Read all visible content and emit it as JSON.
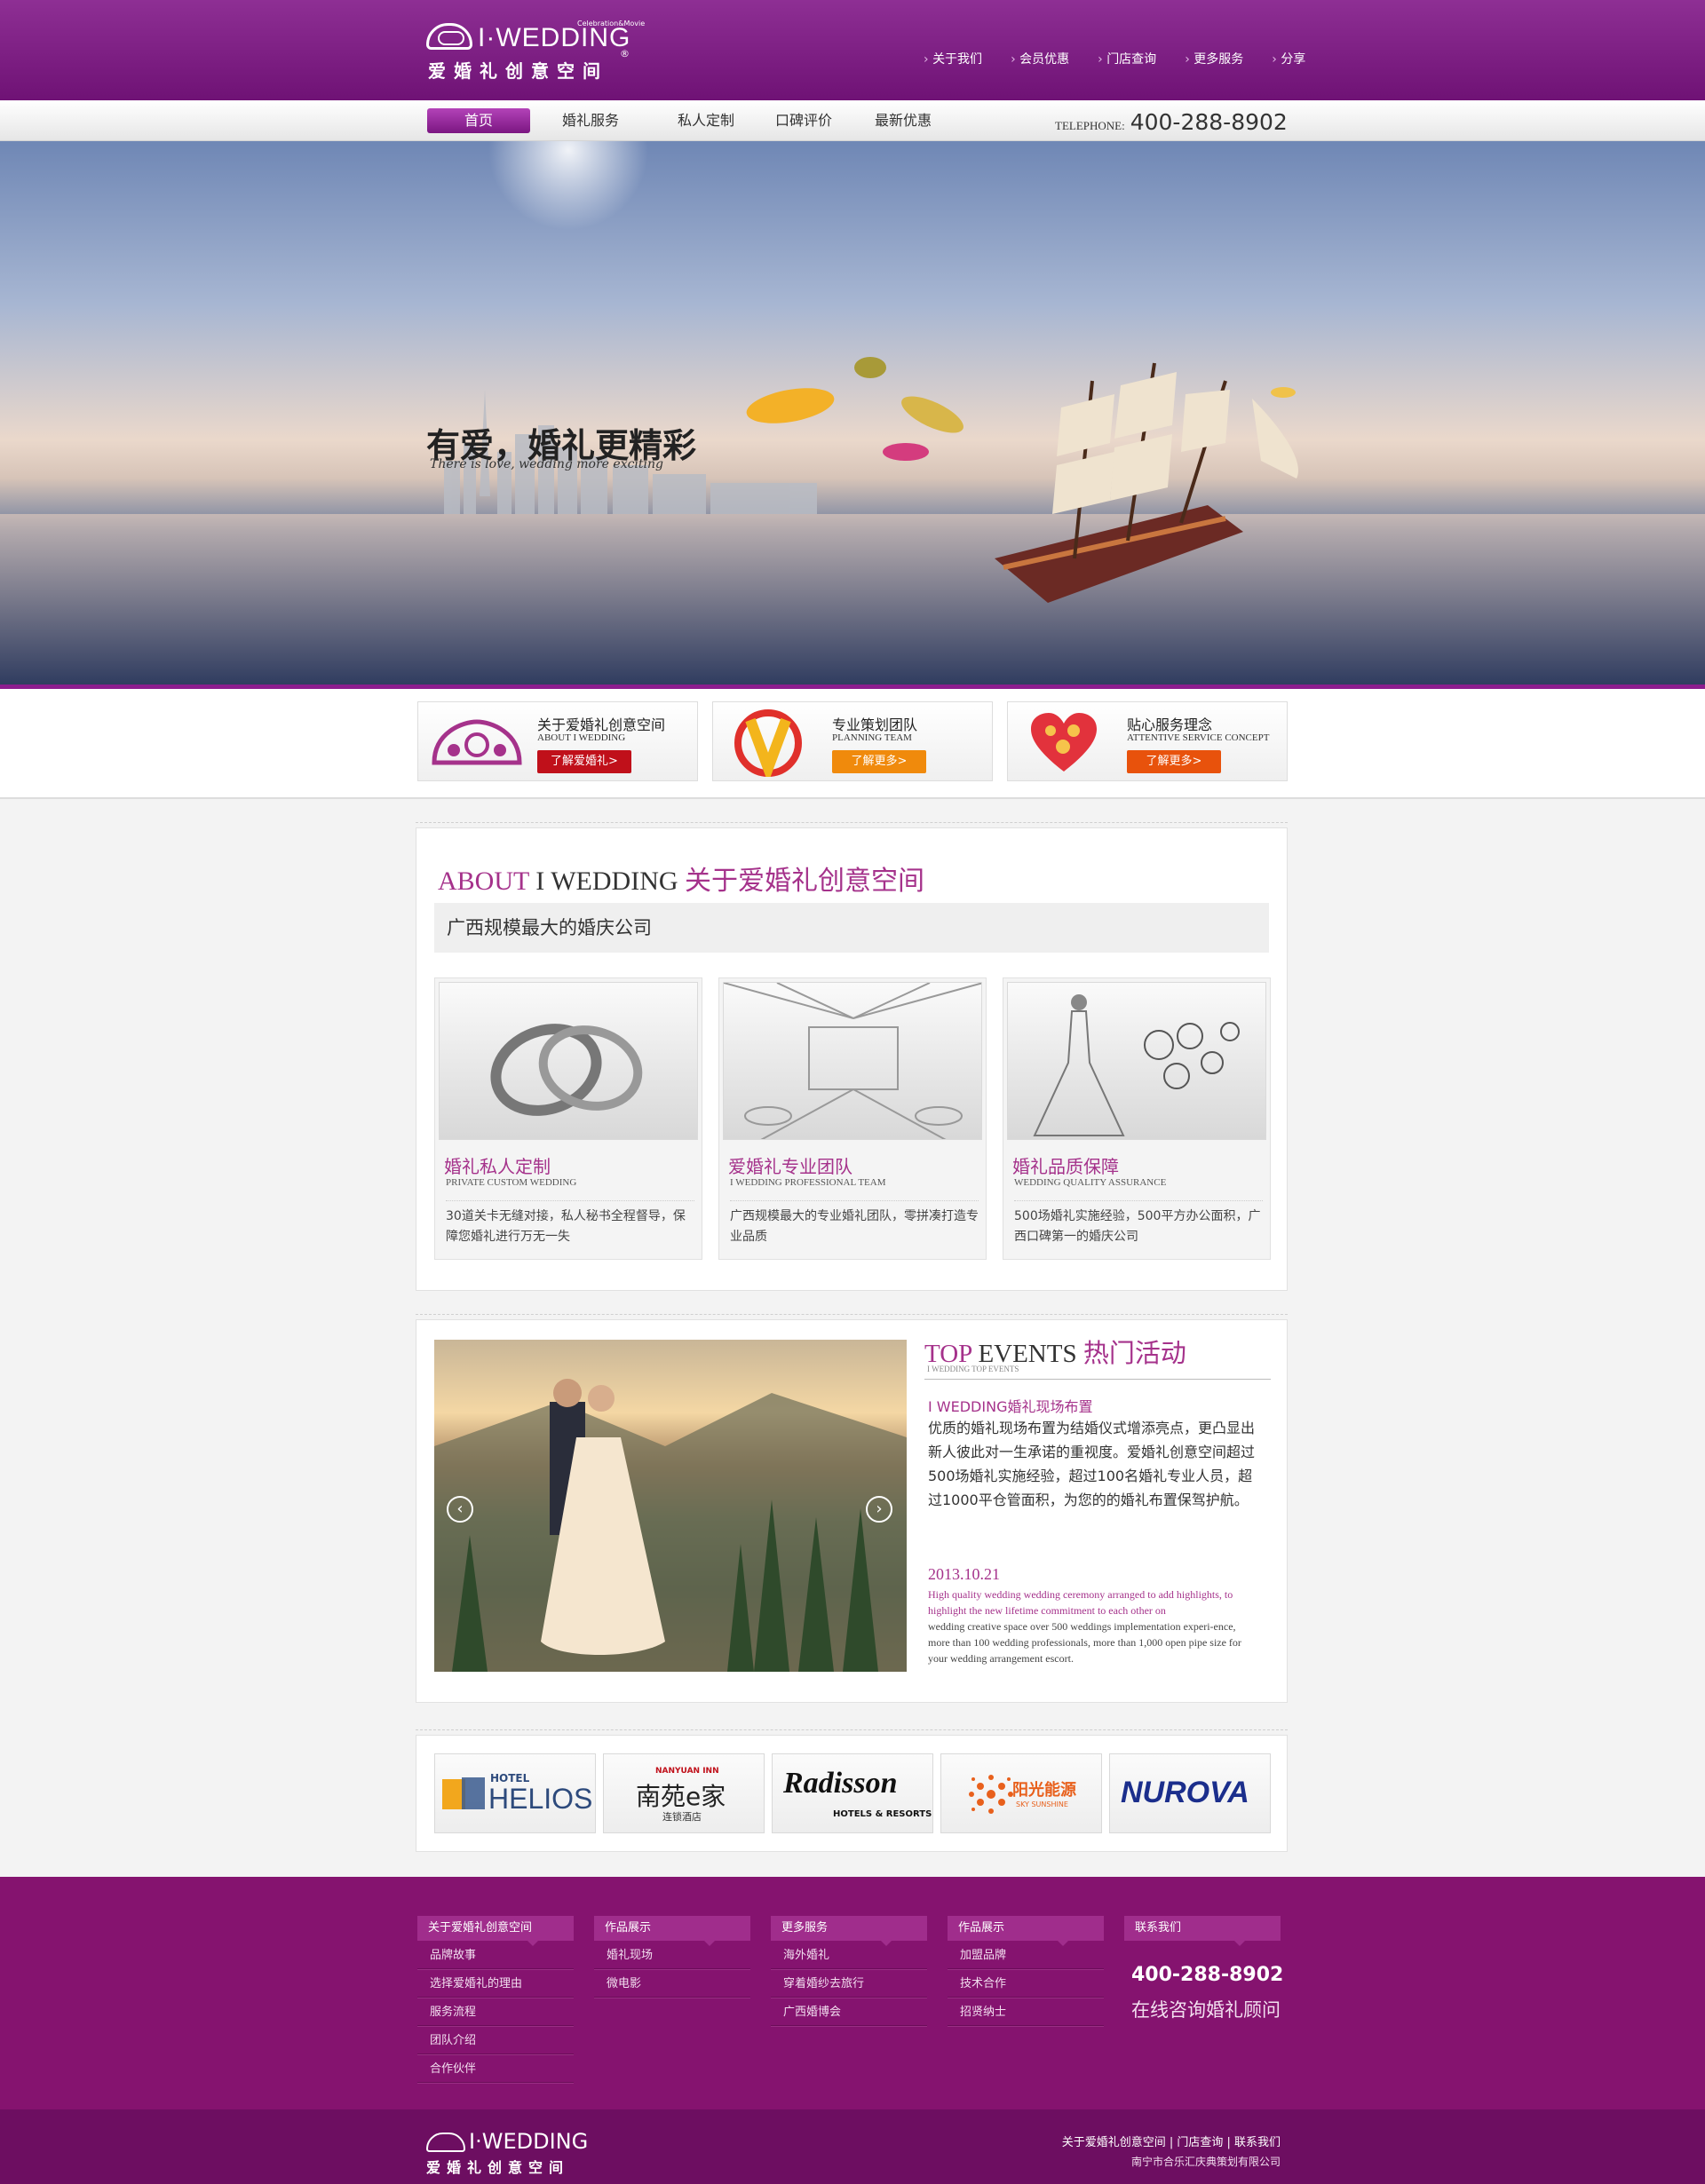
{
  "header": {
    "logo_en": "I·WEDDING",
    "logo_small": "Celebration&Movie",
    "logo_cn": "爱婚礼创意空间",
    "logo_reg": "®",
    "top_links": [
      "关于我们",
      "会员优惠",
      "门店查询",
      "更多服务",
      "分享"
    ]
  },
  "nav": {
    "items": [
      "首页",
      "婚礼服务",
      "私人定制",
      "口碑评价",
      "最新优惠"
    ],
    "telephone_label": "TELEPHONE:",
    "telephone": "400-288-8902"
  },
  "banner": {
    "slogan_cn": "有爱，婚礼更精彩",
    "slogan_en": "There is love, wedding more exciting"
  },
  "info_boxes": [
    {
      "title": "关于爱婚礼创意空间",
      "subtitle": "ABOUT I WEDDING",
      "button": "了解爱婚礼>",
      "color": "#c0101a"
    },
    {
      "title": "专业策划团队",
      "subtitle": "PLANNING TEAM",
      "button": "了解更多>",
      "color": "#f08a0c"
    },
    {
      "title": "贴心服务理念",
      "subtitle": "ATTENTIVE SERVICE CONCEPT",
      "button": "了解更多>",
      "color": "#e8520c"
    }
  ],
  "about": {
    "title_a": "ABOUT",
    "title_b": "I WEDDING",
    "title_c": "关于爱婚礼创意空间",
    "subtitle": "广西规模最大的婚庆公司",
    "cards": [
      {
        "title": "婚礼私人定制",
        "en": "PRIVATE CUSTOM WEDDING",
        "desc": "30道关卡无缝对接，私人秘书全程督导，保障您婚礼进行万无一失"
      },
      {
        "title": "爱婚礼专业团队",
        "en": "I WEDDING PROFESSIONAL TEAM",
        "desc": "广西规模最大的专业婚礼团队，零拼凑打造专业品质"
      },
      {
        "title": "婚礼品质保障",
        "en": "WEDDING QUALITY ASSURANCE",
        "desc": "500场婚礼实施经验，500平方办公面积，广西口碑第一的婚庆公司"
      }
    ]
  },
  "events": {
    "title_a": "TOP",
    "title_b": "EVENTS",
    "title_c": "热门活动",
    "small": "I WEDDING TOP EVENTS",
    "heading": "I WEDDING婚礼现场布置",
    "paragraph": "优质的婚礼现场布置为结婚仪式增添亮点，更凸显出新人彼此对一生承诺的重视度。爱婚礼创意空间超过500场婚礼实施经验，超过100名婚礼专业人员，超过1000平仓管面积，为您的的婚礼布置保驾护航。",
    "date": "2013.10.21",
    "en_highlight": "High quality wedding wedding ceremony arranged to add highlights, to highlight the new lifetime commitment to each other on",
    "en_body": "wedding creative space over 500 weddings implementation experi-ence, more than 100 wedding professionals, more than 1,000 open pipe size for your wedding arrangement escort.",
    "prev": "‹",
    "next": "›"
  },
  "partners": [
    {
      "top": "HOTEL",
      "main": "HELIOS"
    },
    {
      "top": "NANYUAN INN",
      "main": "南苑e家",
      "sub": "连锁酒店"
    },
    {
      "main": "Radisson",
      "sub": "HOTELS & RESORTS"
    },
    {
      "main": "阳光能源",
      "sub": "SKY SUNSHINE"
    },
    {
      "main": "NUROVA"
    }
  ],
  "footer": {
    "columns": [
      {
        "head": "关于爱婚礼创意空间",
        "links": [
          "品牌故事",
          "选择爱婚礼的理由",
          "服务流程",
          "团队介绍",
          "合作伙伴"
        ]
      },
      {
        "head": "作品展示",
        "links": [
          "婚礼现场",
          "微电影"
        ]
      },
      {
        "head": "更多服务",
        "links": [
          "海外婚礼",
          "穿着婚纱去旅行",
          "广西婚博会"
        ]
      },
      {
        "head": "作品展示",
        "links": [
          "加盟品牌",
          "技术合作",
          "招贤纳士"
        ]
      },
      {
        "head": "联系我们",
        "links": []
      }
    ],
    "phone": "400-288-8902",
    "consult": "在线咨询婚礼顾问",
    "bottom_links": "关于爱婚礼创意空间 | 门店查询 | 联系我们",
    "copyright": "南宁市合乐汇庆典策划有限公司"
  },
  "colors": {
    "brand_purple": "#85136f",
    "accent_pink": "#a5328b"
  }
}
